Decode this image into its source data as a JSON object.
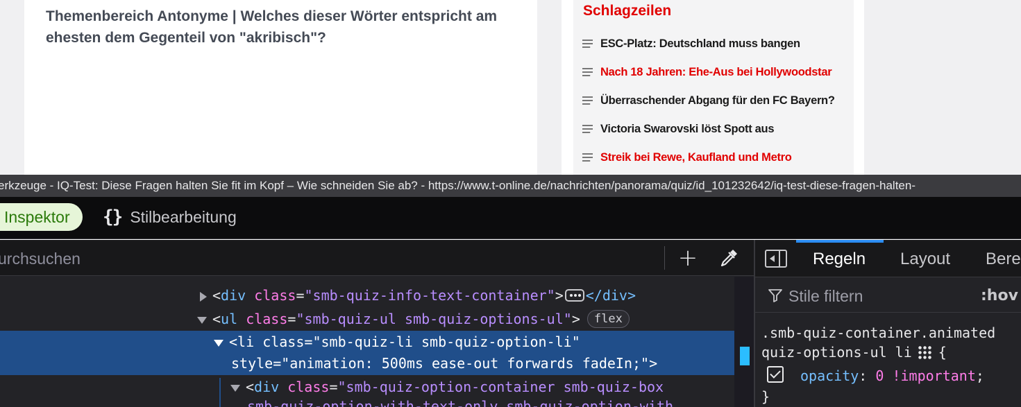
{
  "page": {
    "question": "Themenbereich Antonyme | Welches dieser Wörter entspricht am ehesten dem Gegenteil von \"akribisch\"?",
    "headlines_title": "Schlagzeilen",
    "headlines": [
      {
        "text": "ESC-Platz: Deutschland muss bangen",
        "color": "#1a1a1a"
      },
      {
        "text": "Nach 18 Jahren: Ehe-Aus bei Hollywoodstar",
        "color": "#e10000"
      },
      {
        "text": "Überraschender Abgang für den FC Bayern?",
        "color": "#1a1a1a"
      },
      {
        "text": "Victoria Swarovski löst Spott aus",
        "color": "#1a1a1a"
      },
      {
        "text": "Streik bei Rewe, Kaufland und Metro",
        "color": "#e10000"
      }
    ]
  },
  "devtools": {
    "window_title": "erkzeuge - IQ-Test: Diese Fragen halten Sie fit im Kopf – Wie schneiden Sie ab? - https://www.t-online.de/nachrichten/panorama/quiz/id_101232642/iq-test-diese-fragen-halten-",
    "tabs": {
      "inspector": "Inspektor",
      "style_editor": "Stilbearbeitung",
      "style_editor_icon": "{}"
    },
    "search_placeholder": "urchsuchen",
    "add_icon": "+",
    "markup": {
      "line1": {
        "open": "<",
        "tag": "div",
        "attr": "class",
        "eq": "=",
        "value": "\"smb-quiz-info-text-container\"",
        "gt": ">",
        "close": "</div>"
      },
      "line2": {
        "open": "<",
        "tag": "ul",
        "attr": "class",
        "eq": "=",
        "value": "\"smb-quiz-ul smb-quiz-options-ul\"",
        "gt": ">",
        "badge": "flex"
      },
      "line3": {
        "open": "<",
        "tag": "li",
        "attr": "class",
        "eq": "=",
        "value": "\"smb-quiz-li smb-quiz-option-li\""
      },
      "line4": {
        "attr": "style",
        "eq": "=",
        "value": "\"animation: 500ms ease-out forwards fadeIn;\"",
        "gt": ">"
      },
      "line5": {
        "open": "<",
        "tag": "div",
        "attr": "class",
        "eq": "=",
        "value": "\"smb-quiz-option-container smb-quiz-box"
      },
      "line6": {
        "value": "smb-quiz-option-with-text-only smb-quiz-option-with"
      }
    },
    "rules_tabs": {
      "rules": "Regeln",
      "layout": "Layout",
      "computed": "Bere"
    },
    "filter_placeholder": "Stile filtern",
    "hov": ":hov",
    "rule": {
      "selector_line1": ".smb-quiz-container.animated",
      "selector_line2": "quiz-options-ul li",
      "brace_open": "{",
      "property": "opacity",
      "colon": ":",
      "value": "0 !important",
      "semicolon": ";",
      "brace_close": "}"
    },
    "colors": {
      "selection": "#204e8a",
      "tag": "#75bfff",
      "attr": "#ff7de9",
      "value": "#b98eff",
      "accent": "#2b8bf0"
    }
  }
}
